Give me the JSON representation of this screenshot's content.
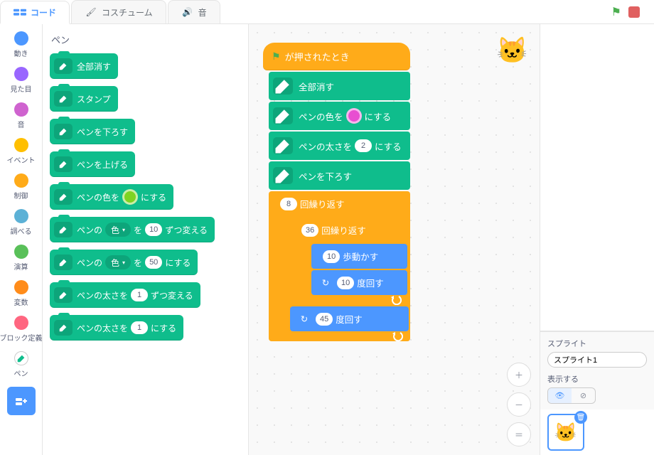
{
  "tabs": {
    "code": "コード",
    "costumes": "コスチューム",
    "sounds": "音"
  },
  "categories": [
    {
      "label": "動き",
      "color": "#4C97FF"
    },
    {
      "label": "見た目",
      "color": "#9966FF"
    },
    {
      "label": "音",
      "color": "#CF63CF"
    },
    {
      "label": "イベント",
      "color": "#FFBF00"
    },
    {
      "label": "制御",
      "color": "#FFAB19"
    },
    {
      "label": "調べる",
      "color": "#5CB1D6"
    },
    {
      "label": "演算",
      "color": "#59C059"
    },
    {
      "label": "変数",
      "color": "#FF8C1A"
    },
    {
      "label": "ブロック定義",
      "color": "#FF6680"
    },
    {
      "label": "ペン",
      "color": "#0FBD8C"
    }
  ],
  "palette": {
    "title": "ペン",
    "eraseAll": "全部消す",
    "stamp": "スタンプ",
    "penDown": "ペンを下ろす",
    "penUp": "ペンを上げる",
    "setColor_pre": "ペンの色を",
    "setColor_post": "にする",
    "setColor_swatch": "#7ED321",
    "changeParam_pre": "ペンの",
    "changeParam_dd": "色",
    "changeParam_mid": "を",
    "changeParam_val": "10",
    "changeParam_post": "ずつ変える",
    "setParam_pre": "ペンの",
    "setParam_dd": "色",
    "setParam_mid": "を",
    "setParam_val": "50",
    "setParam_post": "にする",
    "changeSize_pre": "ペンの太さを",
    "changeSize_val": "1",
    "changeSize_post": "ずつ変える",
    "setSize_pre": "ペンの太さを",
    "setSize_val": "1",
    "setSize_post": "にする"
  },
  "script": {
    "whenFlag": "が押されたとき",
    "eraseAll": "全部消す",
    "setColor_pre": "ペンの色を",
    "setColor_post": "にする",
    "setColor_swatch": "#E84FD1",
    "setSize_pre": "ペンの太さを",
    "setSize_val": "2",
    "setSize_post": "にする",
    "penDown": "ペンを下ろす",
    "repeat_outer_count": "8",
    "repeat_label": "回繰り返す",
    "repeat_inner_count": "36",
    "move_val": "10",
    "move_label": "歩動かす",
    "turn_inner_val": "10",
    "turn_label": "度回す",
    "turn_outer_val": "45"
  },
  "rpanel": {
    "sprite_label": "スプライト",
    "sprite_name": "スプライト1",
    "show_label": "表示する"
  }
}
